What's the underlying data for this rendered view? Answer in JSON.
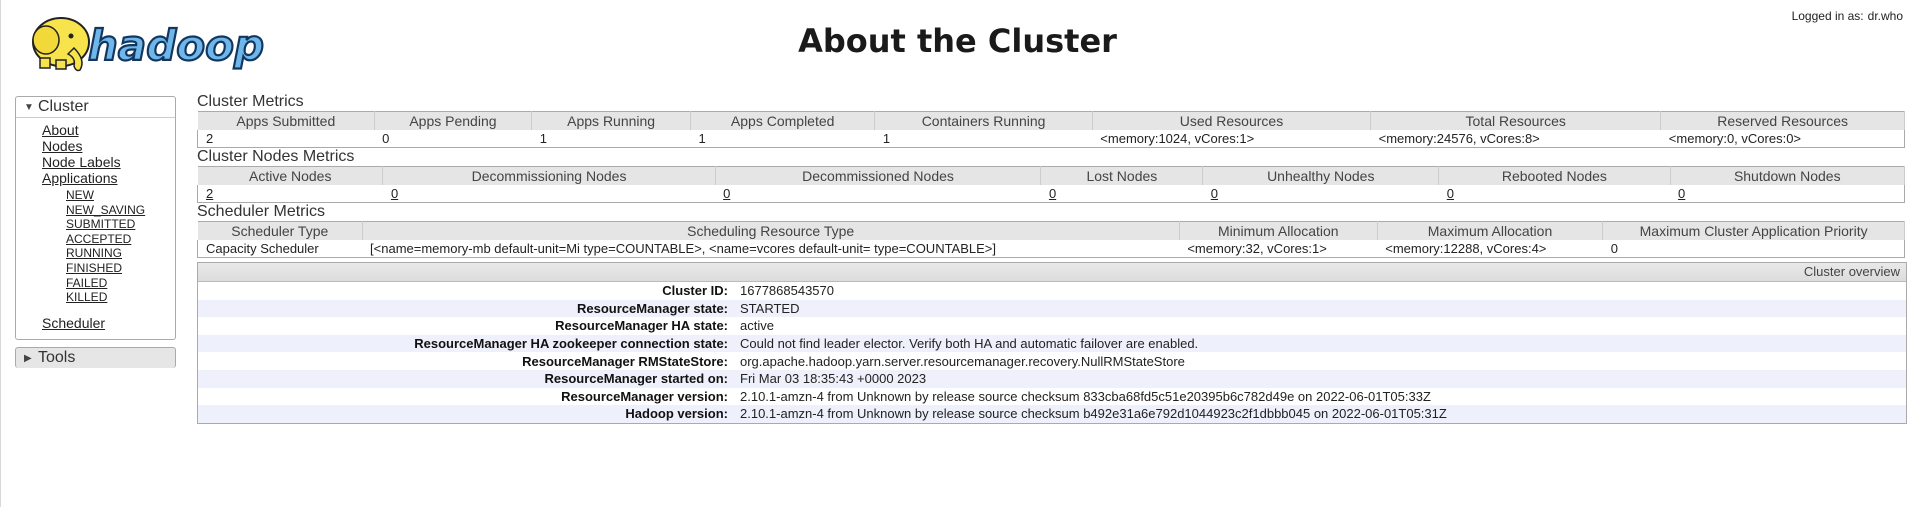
{
  "header": {
    "logo_text": "hadoop",
    "title": "About the Cluster",
    "login_label": "Logged in as:",
    "login_user": "dr.who"
  },
  "sidebar": {
    "cluster_label": "Cluster",
    "items": [
      {
        "label": "About"
      },
      {
        "label": "Nodes"
      },
      {
        "label": "Node Labels"
      },
      {
        "label": "Applications"
      }
    ],
    "app_states": [
      "NEW",
      "NEW_SAVING",
      "SUBMITTED",
      "ACCEPTED",
      "RUNNING",
      "FINISHED",
      "FAILED",
      "KILLED"
    ],
    "scheduler_label": "Scheduler",
    "tools_label": "Tools"
  },
  "cluster_metrics": {
    "title": "Cluster Metrics",
    "headers": [
      "Apps Submitted",
      "Apps Pending",
      "Apps Running",
      "Apps Completed",
      "Containers Running",
      "Used Resources",
      "Total Resources",
      "Reserved Resources"
    ],
    "values": [
      "2",
      "0",
      "1",
      "1",
      "1",
      "<memory:1024, vCores:1>",
      "<memory:24576, vCores:8>",
      "<memory:0, vCores:0>"
    ]
  },
  "node_metrics": {
    "title": "Cluster Nodes Metrics",
    "headers": [
      "Active Nodes",
      "Decommissioning Nodes",
      "Decommissioned Nodes",
      "Lost Nodes",
      "Unhealthy Nodes",
      "Rebooted Nodes",
      "Shutdown Nodes"
    ],
    "values": [
      "2",
      "0",
      "0",
      "0",
      "0",
      "0",
      "0"
    ]
  },
  "scheduler_metrics": {
    "title": "Scheduler Metrics",
    "headers": [
      "Scheduler Type",
      "Scheduling Resource Type",
      "Minimum Allocation",
      "Maximum Allocation",
      "Maximum Cluster Application Priority"
    ],
    "values": [
      "Capacity Scheduler",
      "[<name=memory-mb default-unit=Mi type=COUNTABLE>, <name=vcores default-unit= type=COUNTABLE>]",
      "<memory:32, vCores:1>",
      "<memory:12288, vCores:4>",
      "0"
    ]
  },
  "overview": {
    "title": "Cluster overview",
    "rows": [
      {
        "label": "Cluster ID:",
        "value": "1677868543570"
      },
      {
        "label": "ResourceManager state:",
        "value": "STARTED"
      },
      {
        "label": "ResourceManager HA state:",
        "value": "active"
      },
      {
        "label": "ResourceManager HA zookeeper connection state:",
        "value": "Could not find leader elector. Verify both HA and automatic failover are enabled."
      },
      {
        "label": "ResourceManager RMStateStore:",
        "value": "org.apache.hadoop.yarn.server.resourcemanager.recovery.NullRMStateStore"
      },
      {
        "label": "ResourceManager started on:",
        "value": "Fri Mar 03 18:35:43 +0000 2023"
      },
      {
        "label": "ResourceManager version:",
        "value": "2.10.1-amzn-4 from Unknown by release source checksum 833cba68fd5c51e20395b6c782d49e on 2022-06-01T05:33Z"
      },
      {
        "label": "Hadoop version:",
        "value": "2.10.1-amzn-4 from Unknown by release source checksum b492e31a6e792d1044923c2f1dbbb045 on 2022-06-01T05:31Z"
      }
    ]
  },
  "colors": {
    "logo_blue": "#2f8fd6",
    "logo_yellow": "#f7e44c",
    "header_gray": "#e5e5e5",
    "alt_row": "#eef1fb"
  }
}
